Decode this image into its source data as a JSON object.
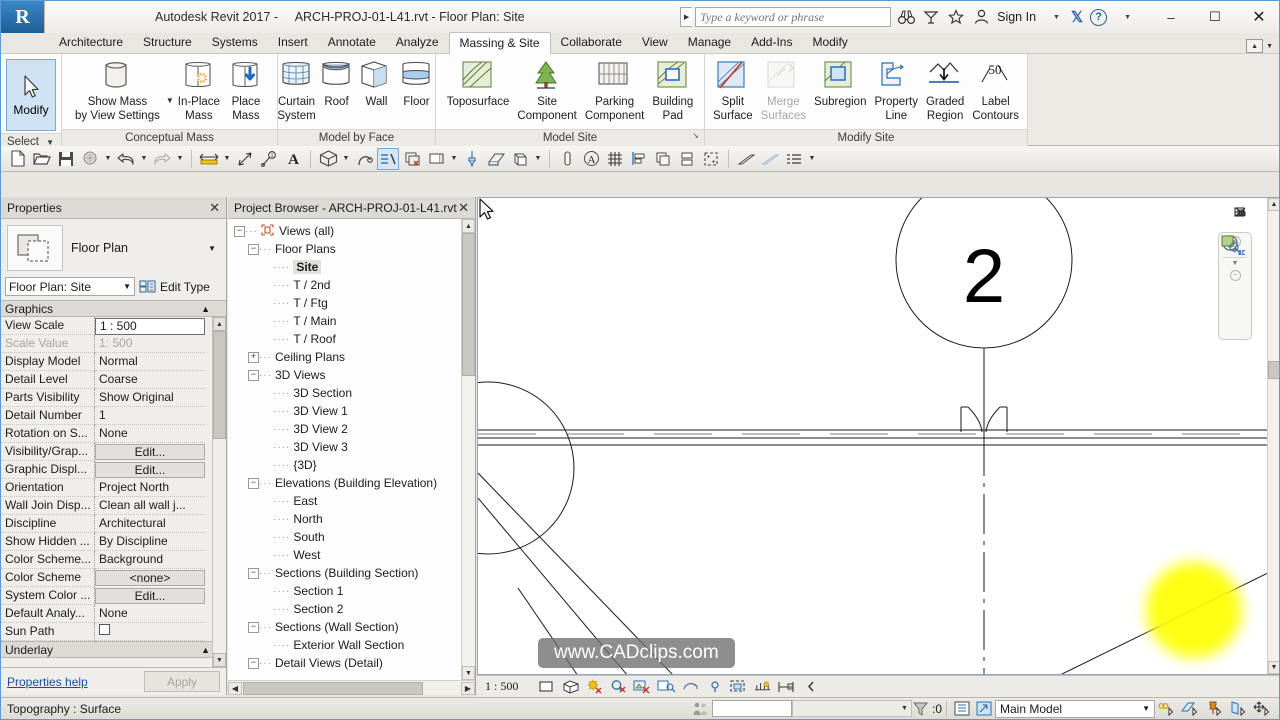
{
  "window": {
    "app_title": "Autodesk Revit 2017 -",
    "document_title": "ARCH-PROJ-01-L41.rvt - Floor Plan: Site",
    "logo": "revit-logo",
    "minimize": "–",
    "maximize": "☐",
    "close": "✕"
  },
  "search": {
    "placeholder": "Type a keyword or phrase",
    "value": "",
    "sign_in": "Sign In",
    "help": "?"
  },
  "ribbon_tabs": [
    {
      "label": "Architecture",
      "active": false
    },
    {
      "label": "Structure",
      "active": false
    },
    {
      "label": "Systems",
      "active": false
    },
    {
      "label": "Insert",
      "active": false
    },
    {
      "label": "Annotate",
      "active": false
    },
    {
      "label": "Analyze",
      "active": false
    },
    {
      "label": "Massing & Site",
      "active": true
    },
    {
      "label": "Collaborate",
      "active": false
    },
    {
      "label": "View",
      "active": false
    },
    {
      "label": "Manage",
      "active": false
    },
    {
      "label": "Add-Ins",
      "active": false
    },
    {
      "label": "Modify",
      "active": false
    }
  ],
  "ribbon": {
    "select_panel": {
      "modify_label": "Modify",
      "panel_label": "Select"
    },
    "conceptual_mass": {
      "panel_label": "Conceptual Mass",
      "buttons": [
        {
          "label_line1": "Show Mass",
          "label_line2": "by View Settings",
          "icon": "show-mass-icon",
          "has_dropdown": true,
          "enabled": true
        },
        {
          "label_line1": "In-Place",
          "label_line2": "Mass",
          "icon": "in-place-mass-icon",
          "has_dropdown": false,
          "enabled": true
        },
        {
          "label_line1": "Place",
          "label_line2": "Mass",
          "icon": "place-mass-icon",
          "has_dropdown": false,
          "enabled": true
        }
      ]
    },
    "model_by_face": {
      "panel_label": "Model by Face",
      "buttons": [
        {
          "label_line1": "Curtain",
          "label_line2": "System",
          "icon": "curtain-system-icon",
          "enabled": true
        },
        {
          "label_line1": "Roof",
          "label_line2": "",
          "icon": "roof-icon",
          "enabled": true
        },
        {
          "label_line1": "Wall",
          "label_line2": "",
          "icon": "wall-icon",
          "enabled": true
        },
        {
          "label_line1": "Floor",
          "label_line2": "",
          "icon": "floor-icon",
          "enabled": true
        }
      ]
    },
    "model_site": {
      "panel_label": "Model Site",
      "buttons": [
        {
          "label_line1": "Toposurface",
          "label_line2": "",
          "icon": "toposurface-icon",
          "enabled": true
        },
        {
          "label_line1": "Site",
          "label_line2": "Component",
          "icon": "site-component-icon",
          "enabled": true
        },
        {
          "label_line1": "Parking",
          "label_line2": "Component",
          "icon": "parking-component-icon",
          "enabled": true
        },
        {
          "label_line1": "Building",
          "label_line2": "Pad",
          "icon": "building-pad-icon",
          "enabled": true
        }
      ]
    },
    "modify_site": {
      "panel_label": "Modify Site",
      "buttons": [
        {
          "label_line1": "Split",
          "label_line2": "Surface",
          "icon": "split-surface-icon",
          "enabled": true
        },
        {
          "label_line1": "Merge",
          "label_line2": "Surfaces",
          "icon": "merge-surfaces-icon",
          "enabled": false
        },
        {
          "label_line1": "Subregion",
          "label_line2": "",
          "icon": "subregion-icon",
          "enabled": true
        },
        {
          "label_line1": "Property",
          "label_line2": "Line",
          "icon": "property-line-icon",
          "enabled": true
        },
        {
          "label_line1": "Graded",
          "label_line2": "Region",
          "icon": "graded-region-icon",
          "enabled": true
        },
        {
          "label_line1": "Label",
          "label_line2": "Contours",
          "icon": "label-contours-icon",
          "enabled": true
        }
      ]
    }
  },
  "properties": {
    "title": "Properties",
    "close": "✕",
    "type_name": "Floor Plan",
    "type_icon": "floor-plan-thumbnail-icon",
    "instance_combo": "Floor Plan: Site",
    "edit_type": "Edit Type",
    "group_header": "Graphics",
    "rows": [
      {
        "name": "View Scale",
        "value": "1 : 500",
        "kind": "boxed",
        "dim": false
      },
      {
        "name": "Scale Value",
        "value": "1:   500",
        "kind": "text",
        "dim": true
      },
      {
        "name": "Display Model",
        "value": "Normal",
        "kind": "text",
        "dim": false
      },
      {
        "name": "Detail Level",
        "value": "Coarse",
        "kind": "text",
        "dim": false
      },
      {
        "name": "Parts Visibility",
        "value": "Show Original",
        "kind": "text",
        "dim": false
      },
      {
        "name": "Detail Number",
        "value": "1",
        "kind": "text",
        "dim": false
      },
      {
        "name": "Rotation on S...",
        "value": "None",
        "kind": "text",
        "dim": false
      },
      {
        "name": "Visibility/Grap...",
        "value": "Edit...",
        "kind": "button",
        "dim": false
      },
      {
        "name": "Graphic Displ...",
        "value": "Edit...",
        "kind": "button",
        "dim": false
      },
      {
        "name": "Orientation",
        "value": "Project North",
        "kind": "text",
        "dim": false
      },
      {
        "name": "Wall Join Disp...",
        "value": "Clean all wall j...",
        "kind": "text",
        "dim": false
      },
      {
        "name": "Discipline",
        "value": "Architectural",
        "kind": "text",
        "dim": false
      },
      {
        "name": "Show Hidden ...",
        "value": "By Discipline",
        "kind": "text",
        "dim": false
      },
      {
        "name": "Color Scheme...",
        "value": "Background",
        "kind": "text",
        "dim": false
      },
      {
        "name": "Color Scheme",
        "value": "<none>",
        "kind": "button",
        "dim": false
      },
      {
        "name": "System Color ...",
        "value": "Edit...",
        "kind": "button",
        "dim": false
      },
      {
        "name": "Default Analy...",
        "value": "None",
        "kind": "text",
        "dim": false
      },
      {
        "name": "Sun Path",
        "value": "",
        "kind": "checkbox",
        "dim": false
      },
      {
        "name": "Underlay",
        "value": "",
        "kind": "group",
        "dim": false
      }
    ],
    "help_link": "Properties help",
    "apply_button": "Apply"
  },
  "browser": {
    "title": "Project Browser - ARCH-PROJ-01-L41.rvt",
    "close": "✕",
    "nodes": [
      {
        "label": "Views (all)",
        "indent": 0,
        "expander": "minus",
        "icon": "views-all-icon",
        "selected": false
      },
      {
        "label": "Floor Plans",
        "indent": 1,
        "expander": "minus",
        "icon": "",
        "selected": false
      },
      {
        "label": "Site",
        "indent": 2,
        "expander": "leaf",
        "icon": "",
        "selected": true
      },
      {
        "label": "T / 2nd",
        "indent": 2,
        "expander": "leaf",
        "icon": "",
        "selected": false
      },
      {
        "label": "T / Ftg",
        "indent": 2,
        "expander": "leaf",
        "icon": "",
        "selected": false
      },
      {
        "label": "T / Main",
        "indent": 2,
        "expander": "leaf",
        "icon": "",
        "selected": false
      },
      {
        "label": "T / Roof",
        "indent": 2,
        "expander": "leaf-end",
        "icon": "",
        "selected": false
      },
      {
        "label": "Ceiling Plans",
        "indent": 1,
        "expander": "plus",
        "icon": "",
        "selected": false
      },
      {
        "label": "3D Views",
        "indent": 1,
        "expander": "minus",
        "icon": "",
        "selected": false
      },
      {
        "label": "3D Section",
        "indent": 2,
        "expander": "leaf",
        "icon": "",
        "selected": false
      },
      {
        "label": "3D View 1",
        "indent": 2,
        "expander": "leaf",
        "icon": "",
        "selected": false
      },
      {
        "label": "3D View 2",
        "indent": 2,
        "expander": "leaf",
        "icon": "",
        "selected": false
      },
      {
        "label": "3D View 3",
        "indent": 2,
        "expander": "leaf",
        "icon": "",
        "selected": false
      },
      {
        "label": "{3D}",
        "indent": 2,
        "expander": "leaf-end",
        "icon": "",
        "selected": false
      },
      {
        "label": "Elevations (Building Elevation)",
        "indent": 1,
        "expander": "minus",
        "icon": "",
        "selected": false
      },
      {
        "label": "East",
        "indent": 2,
        "expander": "leaf",
        "icon": "",
        "selected": false
      },
      {
        "label": "North",
        "indent": 2,
        "expander": "leaf",
        "icon": "",
        "selected": false
      },
      {
        "label": "South",
        "indent": 2,
        "expander": "leaf",
        "icon": "",
        "selected": false
      },
      {
        "label": "West",
        "indent": 2,
        "expander": "leaf-end",
        "icon": "",
        "selected": false
      },
      {
        "label": "Sections (Building Section)",
        "indent": 1,
        "expander": "minus",
        "icon": "",
        "selected": false
      },
      {
        "label": "Section 1",
        "indent": 2,
        "expander": "leaf",
        "icon": "",
        "selected": false
      },
      {
        "label": "Section 2",
        "indent": 2,
        "expander": "leaf-end",
        "icon": "",
        "selected": false
      },
      {
        "label": "Sections (Wall Section)",
        "indent": 1,
        "expander": "minus",
        "icon": "",
        "selected": false
      },
      {
        "label": "Exterior Wall Section",
        "indent": 2,
        "expander": "leaf-end",
        "icon": "",
        "selected": false
      },
      {
        "label": "Detail Views (Detail)",
        "indent": 1,
        "expander": "minus",
        "icon": "",
        "selected": false
      }
    ]
  },
  "canvas": {
    "grid_bubble_label": "2",
    "watermark": "www.CADclips.com",
    "cursor": "arrow-cursor",
    "navbar": {
      "zoom_tool": "zoom-2d-icon",
      "pan_tool": "pan-window-icon"
    },
    "view_controls": {
      "minimize": "minimize-view-icon",
      "restore": "restore-view-icon",
      "close": "close-view-icon"
    }
  },
  "view_control_bar": {
    "scale": "1 : 500",
    "icons": [
      "detail-level-icon",
      "visual-style-icon",
      "sun-path-off-icon",
      "shadows-off-icon",
      "render-dialog-off-icon",
      "crop-view-off-icon",
      "show-crop-region-icon",
      "temporary-hide-isolate-icon",
      "reveal-hidden-elements-icon",
      "analytical-model-off-icon",
      "expand-arrow-icon"
    ]
  },
  "statusbar": {
    "message": "Topography : Surface",
    "worksets_icon": "worksets-icon",
    "editable_box": "",
    "filter_count": ":0",
    "design_option": "Main Model",
    "right_icons": [
      "select-links-icon",
      "select-underlay-icon",
      "select-pinned-icon",
      "select-by-face-icon",
      "drag-elements-icon"
    ]
  }
}
